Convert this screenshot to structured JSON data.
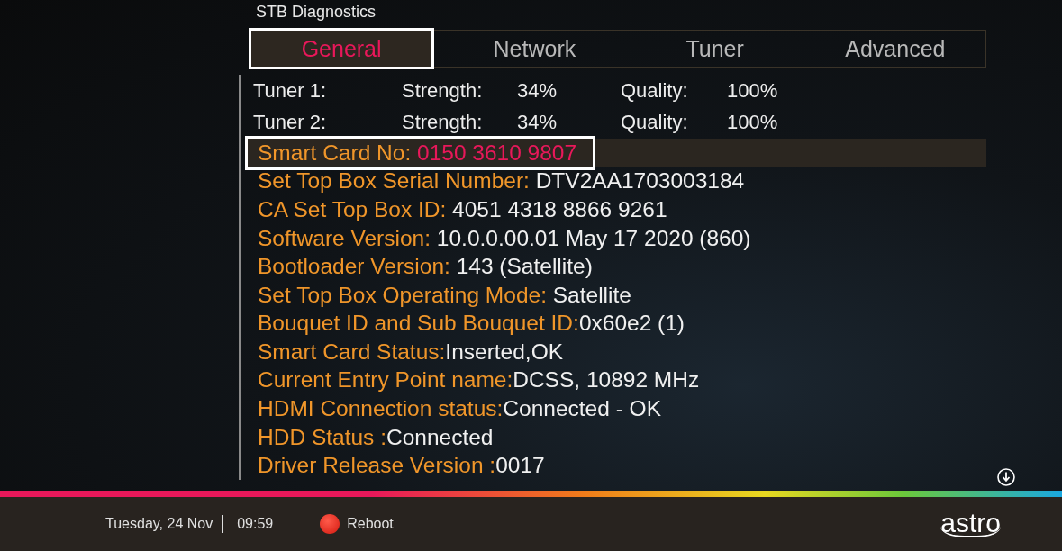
{
  "title": "STB Diagnostics",
  "tabs": [
    {
      "label": "General",
      "selected": true
    },
    {
      "label": "Network",
      "selected": false
    },
    {
      "label": "Tuner",
      "selected": false
    },
    {
      "label": "Advanced",
      "selected": false
    }
  ],
  "tuners": [
    {
      "name": "Tuner 1:",
      "strength_label": "Strength:",
      "strength": "34%",
      "quality_label": "Quality:",
      "quality": "100%"
    },
    {
      "name": "Tuner 2:",
      "strength_label": "Strength:",
      "strength": "34%",
      "quality_label": "Quality:",
      "quality": "100%"
    }
  ],
  "info": [
    {
      "label": "Smart Card No: ",
      "value": "0150 3610 9807",
      "selected": true
    },
    {
      "label": "Set Top Box Serial Number: ",
      "value": "DTV2AA1703003184",
      "selected": false
    },
    {
      "label": "CA Set Top Box ID: ",
      "value": "4051 4318 8866 9261",
      "selected": false
    },
    {
      "label": "Software Version: ",
      "value": "10.0.0.00.01 May 17 2020 (860)",
      "selected": false
    },
    {
      "label": "Bootloader Version: ",
      "value": "143 (Satellite)",
      "selected": false
    },
    {
      "label": "Set Top Box Operating Mode: ",
      "value": "Satellite",
      "selected": false
    },
    {
      "label": "Bouquet ID and Sub Bouquet ID:",
      "value": "0x60e2 (1)",
      "selected": false
    },
    {
      "label": "Smart Card Status:",
      "value": "Inserted,OK",
      "selected": false
    },
    {
      "label": "Current Entry Point name:",
      "value": "DCSS, 10892 MHz",
      "selected": false
    },
    {
      "label": "HDMI Connection status:",
      "value": "Connected - OK",
      "selected": false
    },
    {
      "label": "HDD Status :",
      "value": "Connected",
      "selected": false
    },
    {
      "label": "Driver Release Version :",
      "value": "0017",
      "selected": false
    }
  ],
  "footer": {
    "date": "Tuesday, 24 Nov",
    "time": "09:59",
    "action": "Reboot",
    "logo": "astro"
  }
}
